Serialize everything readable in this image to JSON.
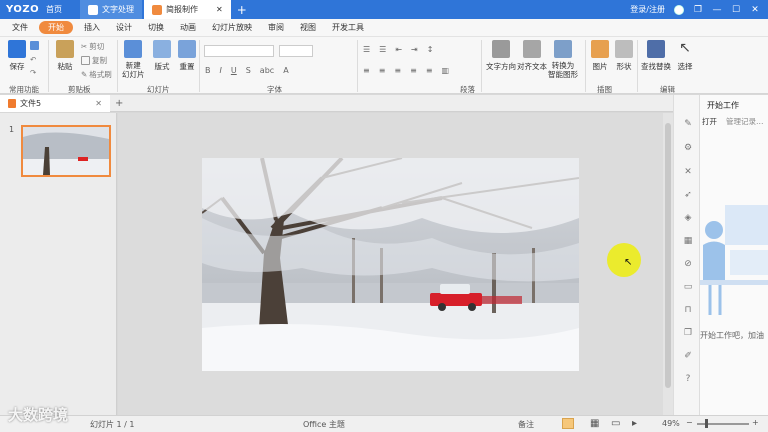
{
  "titlebar": {
    "logo": "YOZO",
    "home": "首页",
    "tabs": [
      {
        "label": "文字处理",
        "icon": "document-icon",
        "color": "#2f75d8"
      },
      {
        "label": "简报制作",
        "icon": "presentation-icon",
        "color": "#f08a3e"
      }
    ],
    "login": "登录/注册"
  },
  "menu": [
    "文件",
    "开始",
    "插入",
    "设计",
    "切换",
    "动画",
    "幻灯片放映",
    "审阅",
    "视图",
    "开发工具"
  ],
  "ribbon": {
    "save": "保存",
    "paste": "粘贴",
    "cut": "剪切",
    "copy": "复制",
    "format_painter": "格式刷",
    "new_slide": "新建\n幻灯片",
    "layout": "版式",
    "reset": "重置",
    "text_direction": "文字方向",
    "align_text": "对齐文本",
    "smart_art": "转换为\n智能图形",
    "picture": "图片",
    "shape": "形状",
    "find_replace": "查找替换",
    "select": "选择",
    "groups": [
      "常用功能",
      "剪贴板",
      "幻灯片",
      "字体",
      "段落",
      "插图",
      "编辑"
    ]
  },
  "doc": {
    "tab": "文件5"
  },
  "thumbnail": {
    "number": "1"
  },
  "taskpane": {
    "title": "开始工作",
    "open": "打开",
    "manage": "管理记录…",
    "desc": "开始工作吧，加油"
  },
  "status": {
    "slide": "幻灯片 1 / 1",
    "theme": "Office 主题",
    "notes": "备注",
    "zoom": "49%"
  },
  "watermark": "大数跨境"
}
